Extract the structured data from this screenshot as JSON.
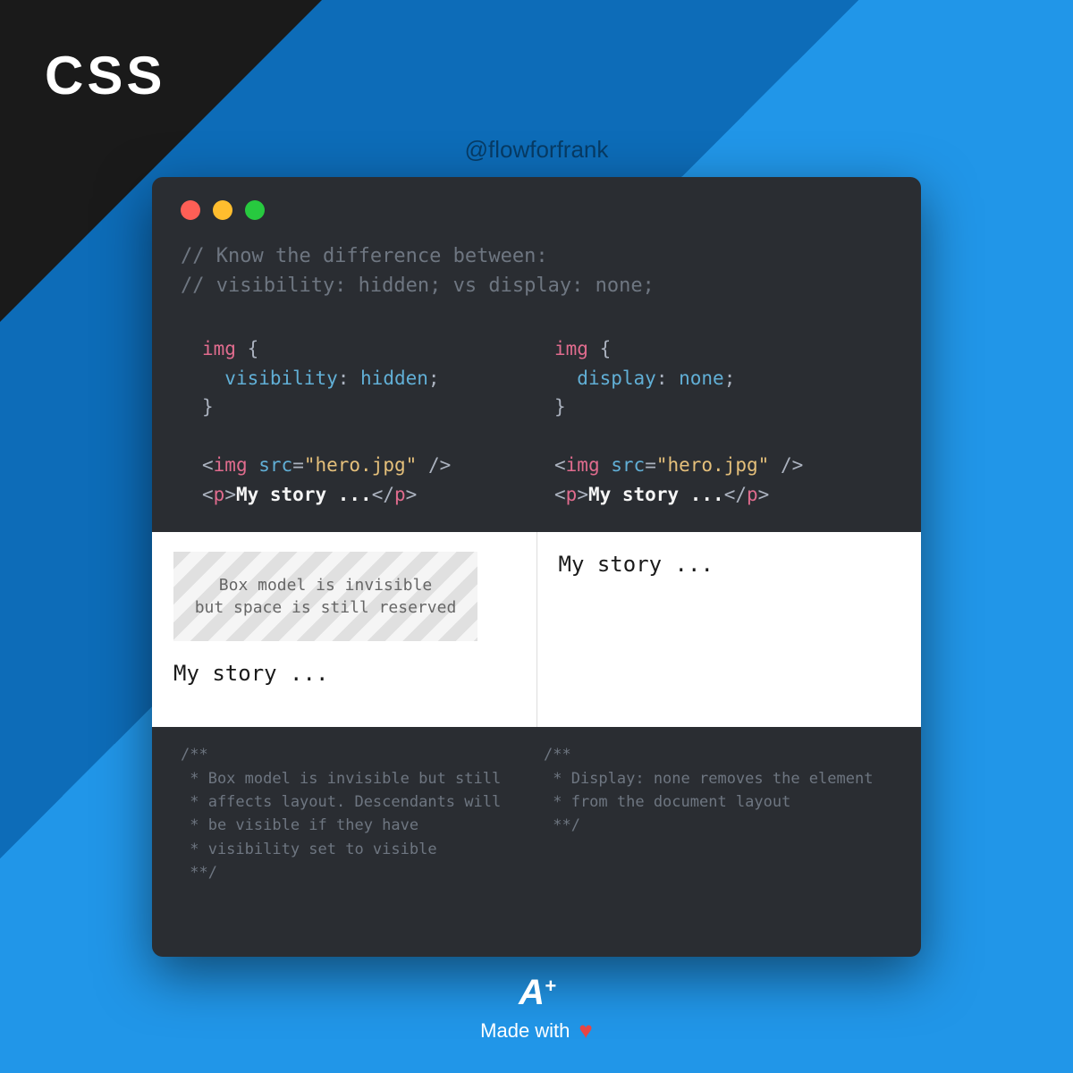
{
  "corner": {
    "label": "CSS"
  },
  "handle": "@flowforfrank",
  "comments": {
    "line1": "// Know the difference between:",
    "line2": "// visibility: hidden; vs display: none;"
  },
  "code": {
    "left": {
      "selector": "img",
      "property": "visibility",
      "value": "hidden",
      "html_img_tag": "img",
      "html_img_attr": "src",
      "html_img_val": "\"hero.jpg\"",
      "html_p_tag": "p",
      "html_p_text": "My story",
      "html_p_ell": " ...",
      "brace_open": " {",
      "brace_close": "}"
    },
    "right": {
      "selector": "img",
      "property": "display",
      "value": "none",
      "html_img_tag": "img",
      "html_img_attr": "src",
      "html_img_val": "\"hero.jpg\"",
      "html_p_tag": "p",
      "html_p_text": "My story",
      "html_p_ell": " ...",
      "brace_open": " {",
      "brace_close": "}"
    }
  },
  "result": {
    "placeholder_l1": "Box model is invisible",
    "placeholder_l2": "but space is still reserved",
    "story_left": "My story ...",
    "story_right": "My story ..."
  },
  "docs": {
    "left": "/**\n * Box model is invisible but still\n * affects layout. Descendants will\n * be visible if they have\n * visibility set to visible\n **/",
    "right": "/**\n * Display: none removes the element\n * from the document layout\n **/"
  },
  "footer": {
    "logo_a": "A",
    "logo_plus": "+",
    "made": "Made with"
  }
}
